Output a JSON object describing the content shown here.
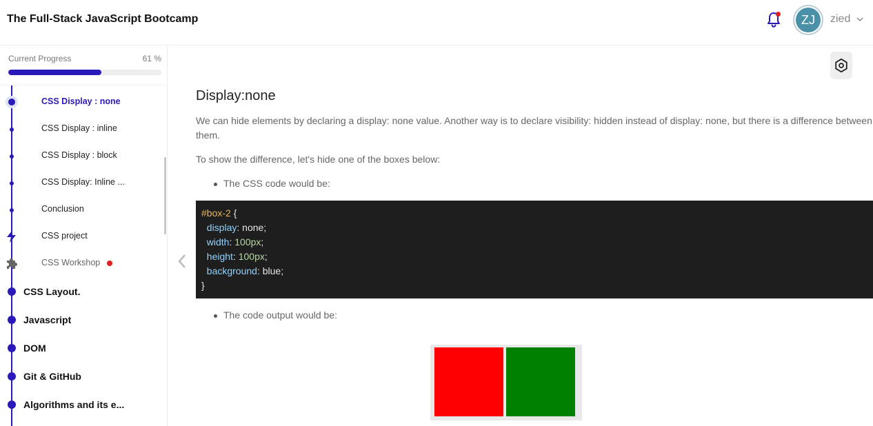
{
  "header": {
    "course_title": "The Full-Stack JavaScript Bootcamp",
    "avatar_initials": "ZJ",
    "username": "zied",
    "notification_dot_color": "#e02020"
  },
  "sidebar": {
    "progress": {
      "label": "Current Progress",
      "percent_text": "61 %",
      "value_percent": 61
    },
    "sub_items": [
      {
        "label": "CSS Display : none",
        "active": true,
        "icon": "active-dot"
      },
      {
        "label": "CSS Display : inline",
        "icon": "dot"
      },
      {
        "label": "CSS Display : block",
        "icon": "dot"
      },
      {
        "label": "CSS Display: Inline ...",
        "icon": "dot"
      },
      {
        "label": "Conclusion",
        "icon": "dot"
      },
      {
        "label": "CSS project",
        "icon": "bolt-icon"
      },
      {
        "label": "CSS Workshop",
        "icon": "puzzle-icon",
        "has_red_dot": true
      }
    ],
    "sections": [
      {
        "label": "CSS Layout."
      },
      {
        "label": "Javascript"
      },
      {
        "label": "DOM"
      },
      {
        "label": "Git & GitHub"
      },
      {
        "label": "Algorithms and its e..."
      }
    ]
  },
  "main": {
    "title": "Display:none",
    "paragraph1": "We can hide elements by declaring a display: none value. Another way is to declare visibility: hidden instead of display: none, but there is a difference between them.",
    "paragraph2": "To show the difference, let's hide one of the boxes below:",
    "bullet1": "The CSS code would be:",
    "code": {
      "selector": "#box-2",
      "open_brace": " {",
      "close_brace": "}",
      "declarations": [
        {
          "prop": "display",
          "value": "none",
          "value_type": "keyword"
        },
        {
          "prop": "width",
          "value": "100px",
          "value_type": "number"
        },
        {
          "prop": "height",
          "value": "100px",
          "value_type": "number"
        },
        {
          "prop": "background",
          "value": "blue",
          "value_type": "keyword"
        }
      ]
    },
    "bullet2": "The code output would be:",
    "demo_box_colors": [
      "#ff0000",
      "#008000"
    ]
  },
  "colors": {
    "accent": "#2a1ab9",
    "code_background": "#1e1e1e"
  }
}
